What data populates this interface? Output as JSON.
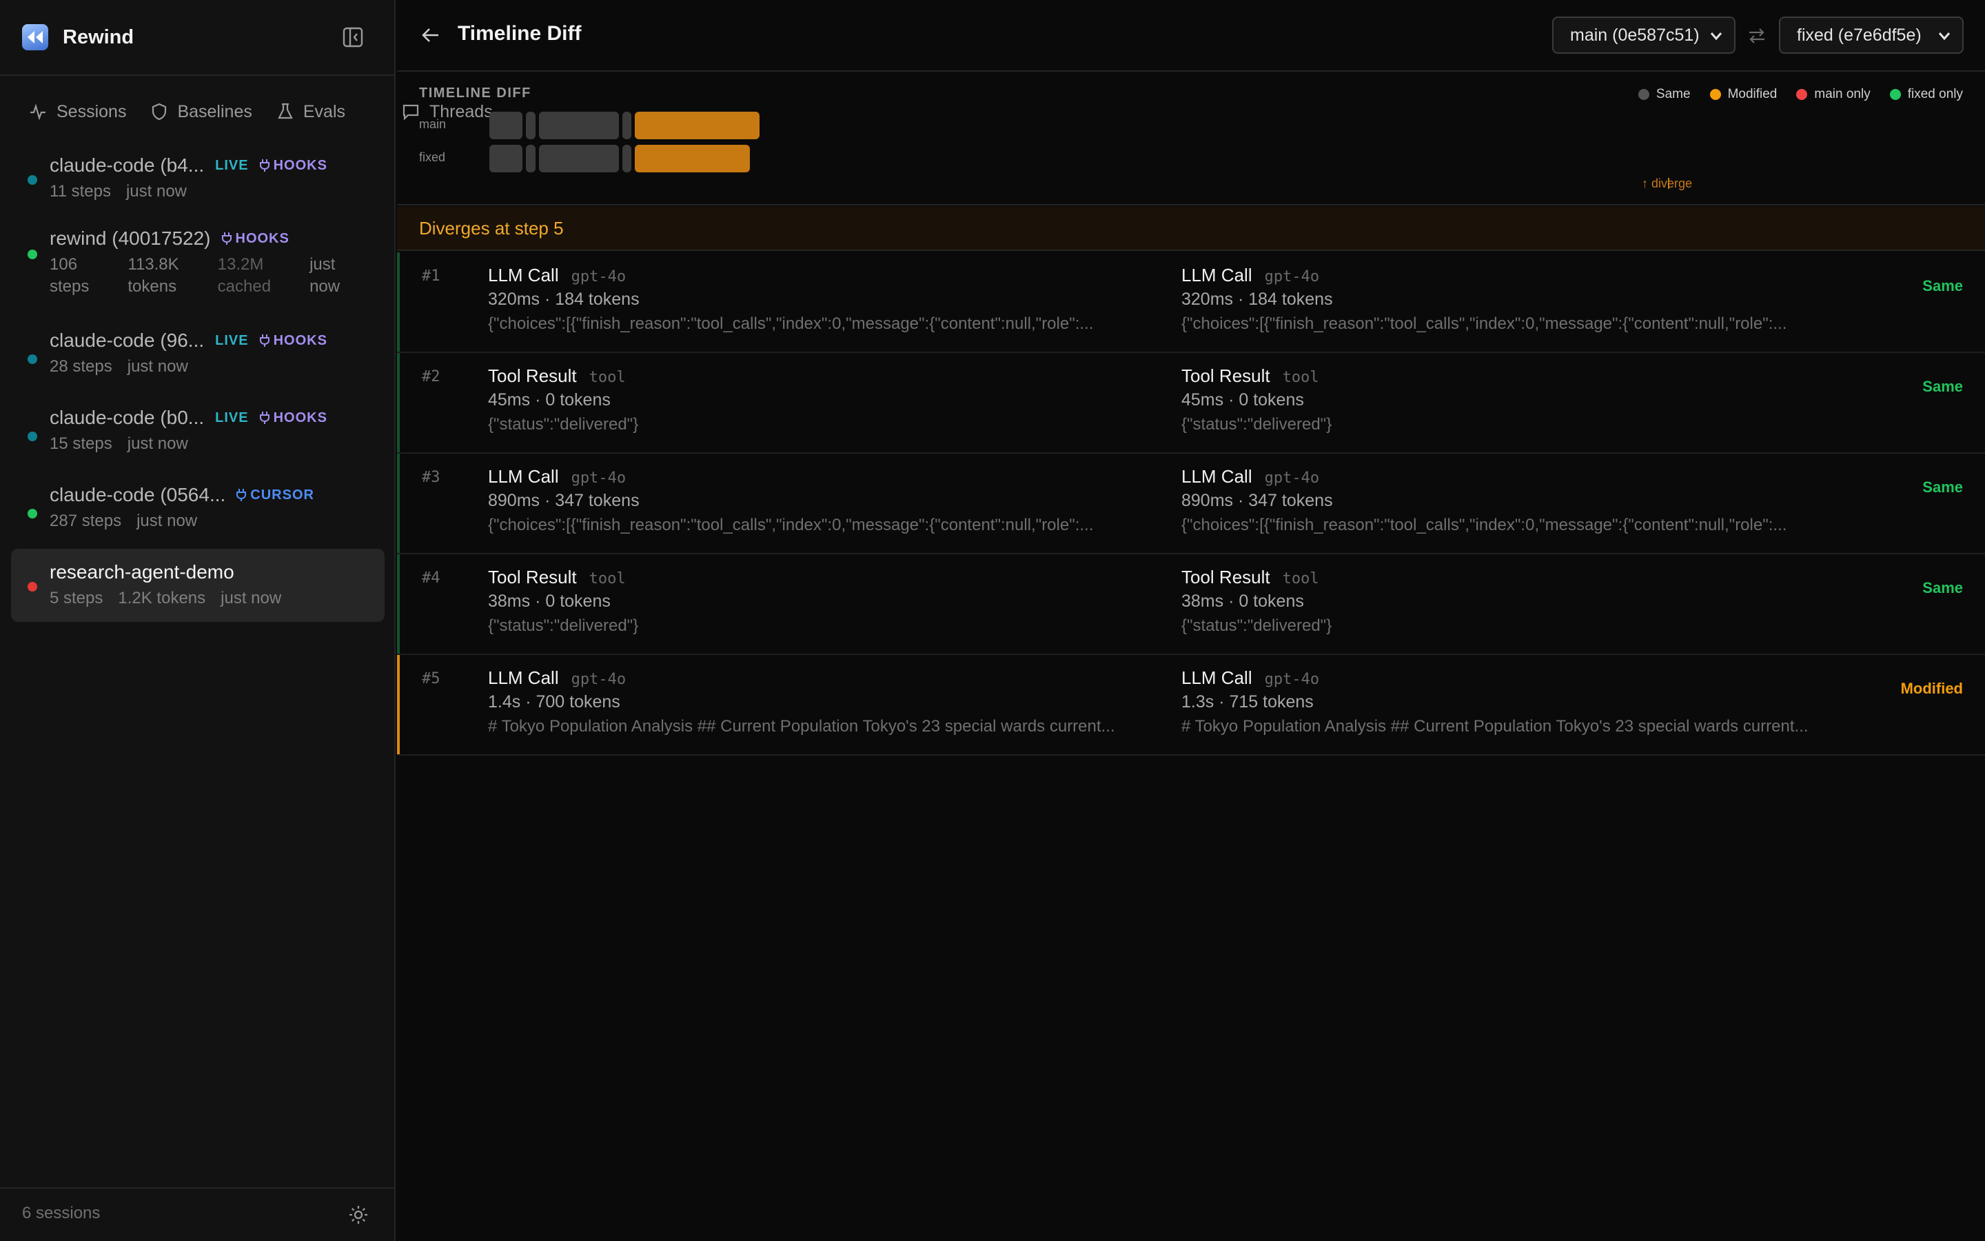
{
  "app": {
    "name": "Rewind"
  },
  "sidebar": {
    "tabs": [
      {
        "label": "Sessions"
      },
      {
        "label": "Baselines"
      },
      {
        "label": "Evals"
      },
      {
        "label": "Threads"
      }
    ],
    "sessions": [
      {
        "title": "claude-code (b4...",
        "status_color": "#0e7f8f",
        "live": "LIVE",
        "plug": "HOOKS",
        "plug_color": "#a48ef0",
        "meta": [
          "11 steps",
          "just now"
        ]
      },
      {
        "title": "rewind (40017522)",
        "status_color": "#22c55e",
        "live": "",
        "plug": "HOOKS",
        "plug_color": "#a48ef0",
        "meta_cols": [
          [
            "106",
            "steps"
          ],
          [
            "113.8K",
            "tokens"
          ],
          [
            "13.2M",
            "cached"
          ],
          [
            "just",
            "now"
          ]
        ]
      },
      {
        "title": "claude-code (96...",
        "status_color": "#0e7f8f",
        "live": "LIVE",
        "plug": "HOOKS",
        "plug_color": "#a48ef0",
        "meta": [
          "28 steps",
          "just now"
        ]
      },
      {
        "title": "claude-code (b0...",
        "status_color": "#0e7f8f",
        "live": "LIVE",
        "plug": "HOOKS",
        "plug_color": "#a48ef0",
        "meta": [
          "15 steps",
          "just now"
        ]
      },
      {
        "title": "claude-code (0564...",
        "status_color": "#22c55e",
        "live": "",
        "plug": "CURSOR",
        "plug_color": "#4d8ef5",
        "meta": [
          "287 steps",
          "just now"
        ]
      },
      {
        "title": "research-agent-demo",
        "status_color": "#e53935",
        "live": "",
        "plug": "",
        "plug_color": "",
        "meta": [
          "5 steps",
          "1.2K tokens",
          "just now"
        ]
      }
    ],
    "footer": {
      "count": "6 sessions"
    }
  },
  "header": {
    "title": "Timeline Diff",
    "left_select": "main (0e587c51)",
    "right_select": "fixed (e7e6df5e)"
  },
  "overview": {
    "heading": "TIMELINE DIFF",
    "lanes": [
      {
        "label": "main"
      },
      {
        "label": "fixed"
      }
    ],
    "legend": [
      {
        "label": "Same",
        "color": "#555555"
      },
      {
        "label": "Modified",
        "color": "#f59e0b"
      },
      {
        "label": "main only",
        "color": "#ef4444"
      },
      {
        "label": "fixed only",
        "color": "#22c55e"
      }
    ],
    "diverge_label": "↑ diverge"
  },
  "banner": {
    "text": "Diverges at step 5"
  },
  "steps": [
    {
      "num": "#1",
      "status": "Same",
      "status_color": "#22c55e",
      "left": {
        "name": "LLM Call",
        "type": "gpt-4o",
        "stats": "320ms · 184 tokens",
        "body": "{\"choices\":[{\"finish_reason\":\"tool_calls\",\"index\":0,\"message\":{\"content\":null,\"role\":..."
      },
      "right": {
        "name": "LLM Call",
        "type": "gpt-4o",
        "stats": "320ms · 184 tokens",
        "body": "{\"choices\":[{\"finish_reason\":\"tool_calls\",\"index\":0,\"message\":{\"content\":null,\"role\":..."
      }
    },
    {
      "num": "#2",
      "status": "Same",
      "status_color": "#22c55e",
      "left": {
        "name": "Tool Result",
        "type": "tool",
        "stats": "45ms · 0 tokens",
        "body": "{\"status\":\"delivered\"}"
      },
      "right": {
        "name": "Tool Result",
        "type": "tool",
        "stats": "45ms · 0 tokens",
        "body": "{\"status\":\"delivered\"}"
      }
    },
    {
      "num": "#3",
      "status": "Same",
      "status_color": "#22c55e",
      "left": {
        "name": "LLM Call",
        "type": "gpt-4o",
        "stats": "890ms · 347 tokens",
        "body": "{\"choices\":[{\"finish_reason\":\"tool_calls\",\"index\":0,\"message\":{\"content\":null,\"role\":..."
      },
      "right": {
        "name": "LLM Call",
        "type": "gpt-4o",
        "stats": "890ms · 347 tokens",
        "body": "{\"choices\":[{\"finish_reason\":\"tool_calls\",\"index\":0,\"message\":{\"content\":null,\"role\":..."
      }
    },
    {
      "num": "#4",
      "status": "Same",
      "status_color": "#22c55e",
      "left": {
        "name": "Tool Result",
        "type": "tool",
        "stats": "38ms · 0 tokens",
        "body": "{\"status\":\"delivered\"}"
      },
      "right": {
        "name": "Tool Result",
        "type": "tool",
        "stats": "38ms · 0 tokens",
        "body": "{\"status\":\"delivered\"}"
      }
    },
    {
      "num": "#5",
      "status": "Modified",
      "status_color": "#f59e0b",
      "left": {
        "name": "LLM Call",
        "type": "gpt-4o",
        "stats": "1.4s · 700 tokens",
        "body": "# Tokyo Population Analysis ## Current Population Tokyo's 23 special wards current..."
      },
      "right": {
        "name": "LLM Call",
        "type": "gpt-4o",
        "stats": "1.3s · 715 tokens",
        "body": "# Tokyo Population Analysis ## Current Population Tokyo's 23 special wards current..."
      }
    }
  ]
}
